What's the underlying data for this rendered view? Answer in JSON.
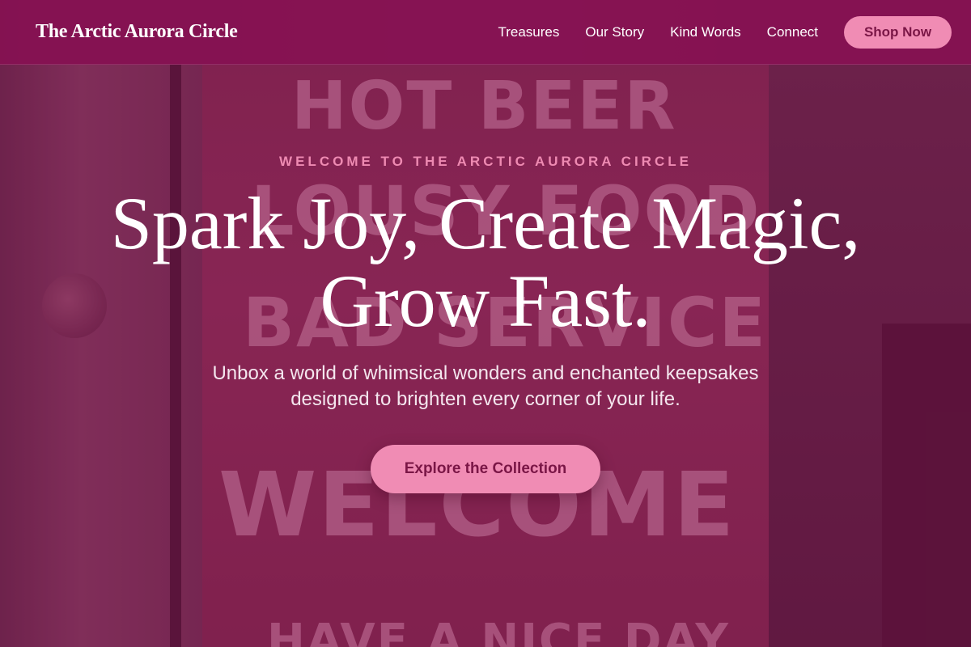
{
  "header": {
    "brand": "The Arctic Aurora Circle",
    "nav": [
      "Treasures",
      "Our Story",
      "Kind Words",
      "Connect"
    ],
    "cta_label": "Shop Now"
  },
  "hero": {
    "eyebrow": "WELCOME TO THE ARCTIC AURORA CIRCLE",
    "headline_line1": "Spark Joy, Create Magic,",
    "headline_line2": "Grow Fast.",
    "subtext": "Unbox a world of whimsical wonders and enchanted keepsakes designed to brighten every corner of your life.",
    "cta_label": "Explore the Collection",
    "background_sign_lines": [
      "HOT BEER",
      "LOUSY FOOD",
      "BAD SERVICE",
      "WELCOME",
      "HAVE A NICE DAY"
    ]
  },
  "colors": {
    "accent": "#f08cb4",
    "header_bg": "#881254",
    "accent_text": "#7a1646",
    "eyebrow": "#ee8ab2"
  }
}
